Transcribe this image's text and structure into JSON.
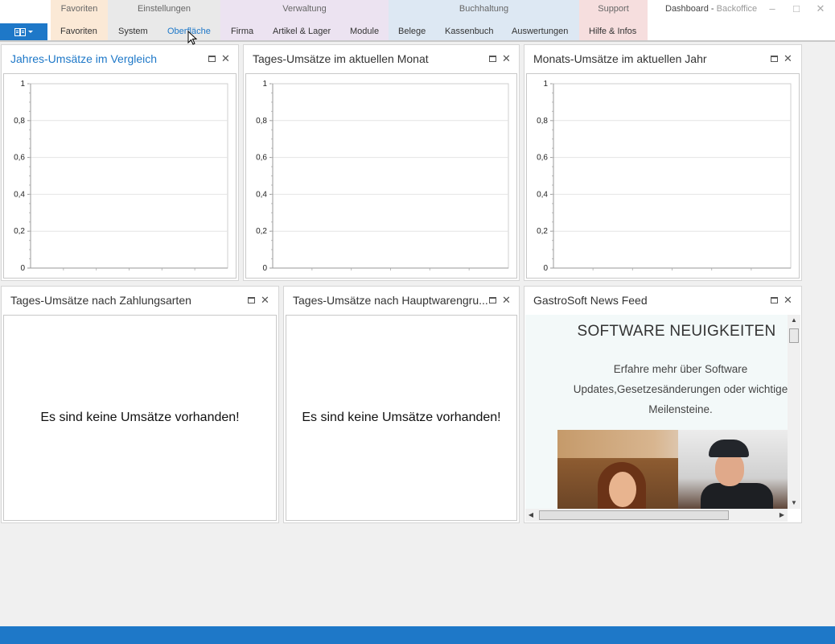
{
  "ribbon": {
    "groups": [
      {
        "title": "Favoriten",
        "color": "#fbe9d6",
        "tabs": [
          "Favoriten"
        ]
      },
      {
        "title": "Einstellungen",
        "color": "#e9e9e9",
        "tabs": [
          "System",
          "Oberfläche"
        ]
      },
      {
        "title": "Verwaltung",
        "color": "#ece3f1",
        "tabs": [
          "Firma",
          "Artikel & Lager",
          "Module"
        ]
      },
      {
        "title": "Buchhaltung",
        "color": "#dde8f3",
        "tabs": [
          "Belege",
          "Kassenbuch",
          "Auswertungen"
        ]
      },
      {
        "title": "Support",
        "color": "#f6dede",
        "tabs": [
          "Hilfe & Infos"
        ]
      }
    ],
    "active_tab": "Oberfläche"
  },
  "window": {
    "title": "Dashboard",
    "separator": " - ",
    "subtitle": "Backoffice"
  },
  "panels": {
    "yearly": {
      "title": "Jahres-Umsätze im Vergleich"
    },
    "daily_month": {
      "title": "Tages-Umsätze im aktuellen Monat"
    },
    "monthly_year": {
      "title": "Monats-Umsätze im aktuellen Jahr"
    },
    "payment_types": {
      "title": "Tages-Umsätze nach Zahlungsarten",
      "message": "Es sind keine Umsätze vorhanden!"
    },
    "main_groups": {
      "title": "Tages-Umsätze nach Hauptwarengru...",
      "message": "Es sind keine Umsätze vorhanden!"
    },
    "news": {
      "title": "GastroSoft News Feed",
      "heading": "SOFTWARE NEUIGKEITEN",
      "text": "Erfahre mehr über Software Updates,Gesetzesänderungen oder wichtige Meilensteine."
    }
  },
  "chart_data": [
    {
      "type": "line",
      "title": "Jahres-Umsätze im Vergleich",
      "series": [],
      "ylim": [
        0,
        1
      ],
      "yticks": [
        "1",
        "0,8",
        "0,6",
        "0,4",
        "0,2",
        "0"
      ],
      "grid": true
    },
    {
      "type": "line",
      "title": "Tages-Umsätze im aktuellen Monat",
      "series": [],
      "ylim": [
        0,
        1
      ],
      "yticks": [
        "1",
        "0,8",
        "0,6",
        "0,4",
        "0,2",
        "0"
      ],
      "grid": true
    },
    {
      "type": "line",
      "title": "Monats-Umsätze im aktuellen Jahr",
      "series": [],
      "ylim": [
        0,
        1
      ],
      "yticks": [
        "1",
        "0,8",
        "0,6",
        "0,4",
        "0,2",
        "0"
      ],
      "grid": true
    }
  ],
  "icons": {
    "app_menu": "book-icon",
    "minimize": "minimize-icon",
    "maximize": "maximize-icon",
    "close": "close-icon",
    "panel_maximize": "panel-maximize-icon",
    "panel_close": "panel-close-icon"
  },
  "colors": {
    "accent": "#1e78c8",
    "statusbar": "#1e78c8",
    "news_background": "#f3f9f9"
  }
}
